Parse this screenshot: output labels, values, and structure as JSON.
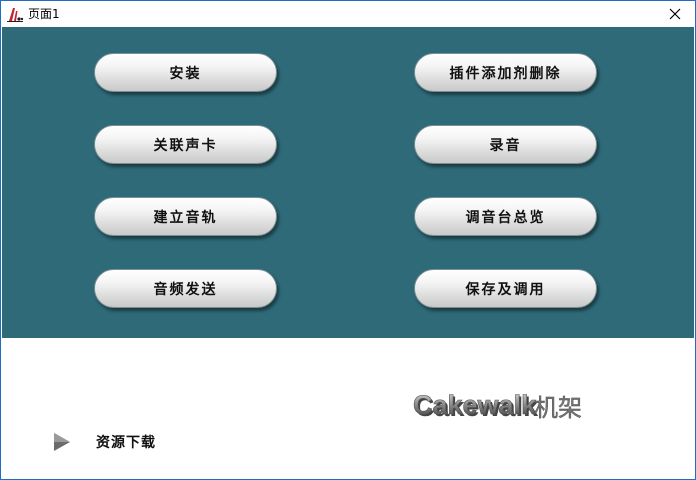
{
  "window": {
    "title": "页面1"
  },
  "buttons": {
    "install": "安装",
    "plugin_manage": "插件添加剂删除",
    "link_soundcard": "关联声卡",
    "record": "录音",
    "create_track": "建立音轨",
    "mixer_overview": "调音台总览",
    "audio_send": "音频发送",
    "save_load": "保存及调用"
  },
  "logo": {
    "brand": "Cakewalk",
    "suffix": "机架"
  },
  "download": {
    "label": "资源下载"
  },
  "colors": {
    "panel": "#2f6a78",
    "border": "#1e6fc2"
  },
  "icons": {
    "app": "cakewalk-app-icon",
    "close": "close-icon",
    "play": "play-arrow-icon"
  }
}
